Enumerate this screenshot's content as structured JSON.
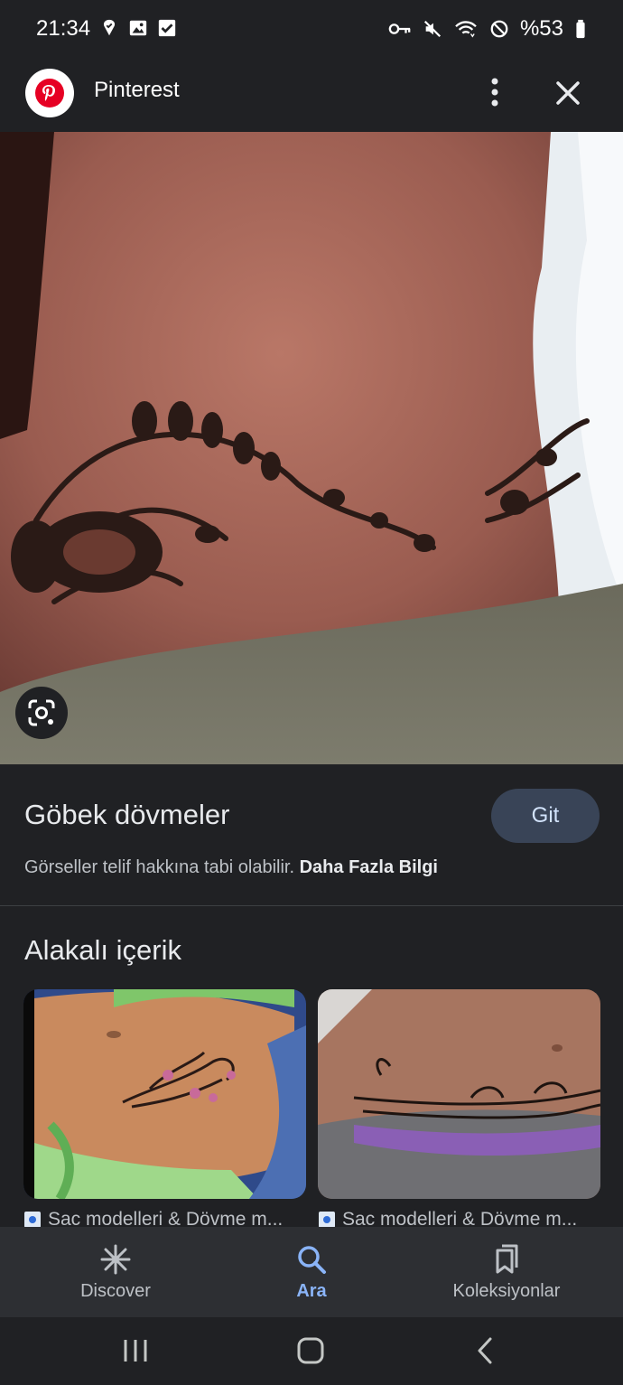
{
  "status_bar": {
    "time": "21:34",
    "battery": "%53",
    "left_icons": [
      "location-check-icon",
      "image-icon",
      "checkbox-icon"
    ],
    "right_icons": [
      "key-icon",
      "mute-icon",
      "wifi-icon",
      "do-not-disturb-icon",
      "battery-icon"
    ]
  },
  "header": {
    "site_name": "Pinterest",
    "logo_icon": "pinterest-logo-icon",
    "menu_icon": "more-vert-icon",
    "close_icon": "close-icon"
  },
  "result": {
    "title": "Göbek dövmeler",
    "visit_label": "Git",
    "copyright_text": "Görseller telif hakkına tabi olabilir.",
    "learn_more": "Daha Fazla Bilgi"
  },
  "related": {
    "heading": "Alakalı içerik",
    "cards": [
      {
        "caption": "Sac modelleri & Dövme m..."
      },
      {
        "caption": "Sac modelleri & Dövme m..."
      }
    ]
  },
  "bottom_nav": {
    "items": [
      {
        "label": "Discover",
        "icon": "asterisk-icon",
        "active": false
      },
      {
        "label": "Ara",
        "icon": "search-icon",
        "active": true
      },
      {
        "label": "Koleksiyonlar",
        "icon": "bookmarks-icon",
        "active": false
      }
    ]
  },
  "colors": {
    "background": "#202124",
    "accent": "#8ab4f8",
    "button_bg": "#394457",
    "pinterest_red": "#e60023"
  }
}
